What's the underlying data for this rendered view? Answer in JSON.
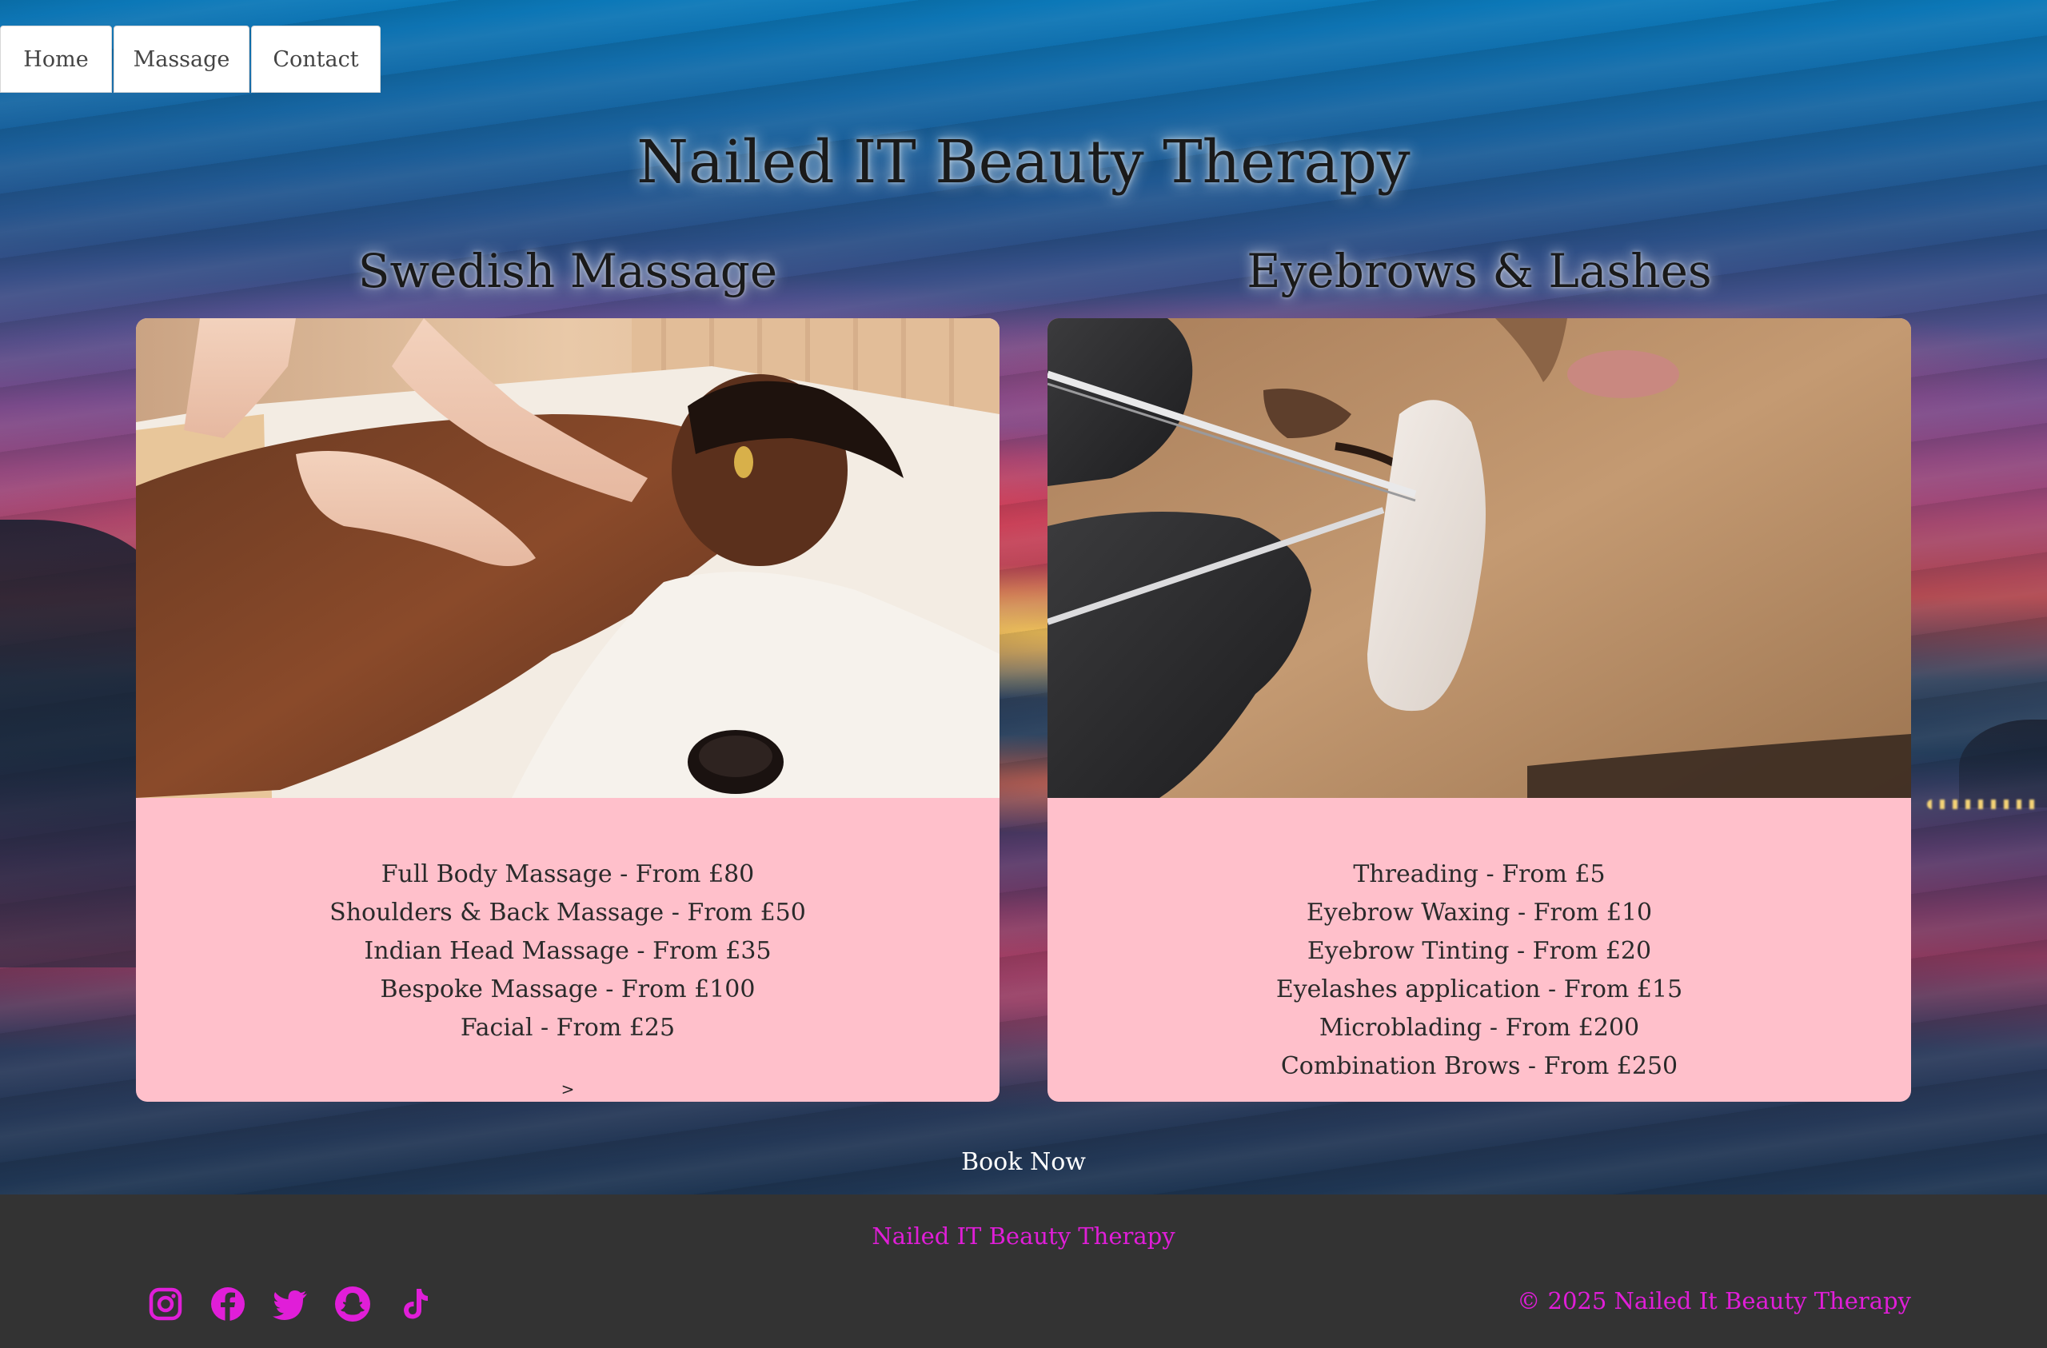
{
  "nav": {
    "tabs": [
      {
        "label": "Home"
      },
      {
        "label": "Massage"
      },
      {
        "label": "Contact"
      }
    ]
  },
  "site_title": "Nailed IT Beauty Therapy",
  "sections": [
    {
      "heading": "Swedish Massage",
      "photo": "massage-photo",
      "services": [
        "Full Body Massage - From £80",
        "Shoulders & Back Massage - From £50",
        "Indian Head Massage - From £35",
        "Bespoke Massage - From £100",
        "Facial - From £25"
      ],
      "more": ">"
    },
    {
      "heading": "Eyebrows & Lashes",
      "photo": "lashes-photo",
      "services": [
        "Threading - From £5",
        "Eyebrow Waxing - From £10",
        "Eyebrow Tinting - From £20",
        "Eyelashes application - From £15",
        "Microblading - From £200",
        "Combination Brows - From £250"
      ]
    }
  ],
  "book_now": "Book Now",
  "footer": {
    "title": "Nailed IT Beauty Therapy",
    "social_icons": [
      "instagram-icon",
      "facebook-icon",
      "twitter-icon",
      "snapchat-icon",
      "tiktok-icon"
    ],
    "copyright": "© 2025 Nailed It Beauty Therapy"
  },
  "colors": {
    "card_background": "#ffc0cb",
    "footer_background": "#333333",
    "footer_accent": "#e01ed8"
  }
}
